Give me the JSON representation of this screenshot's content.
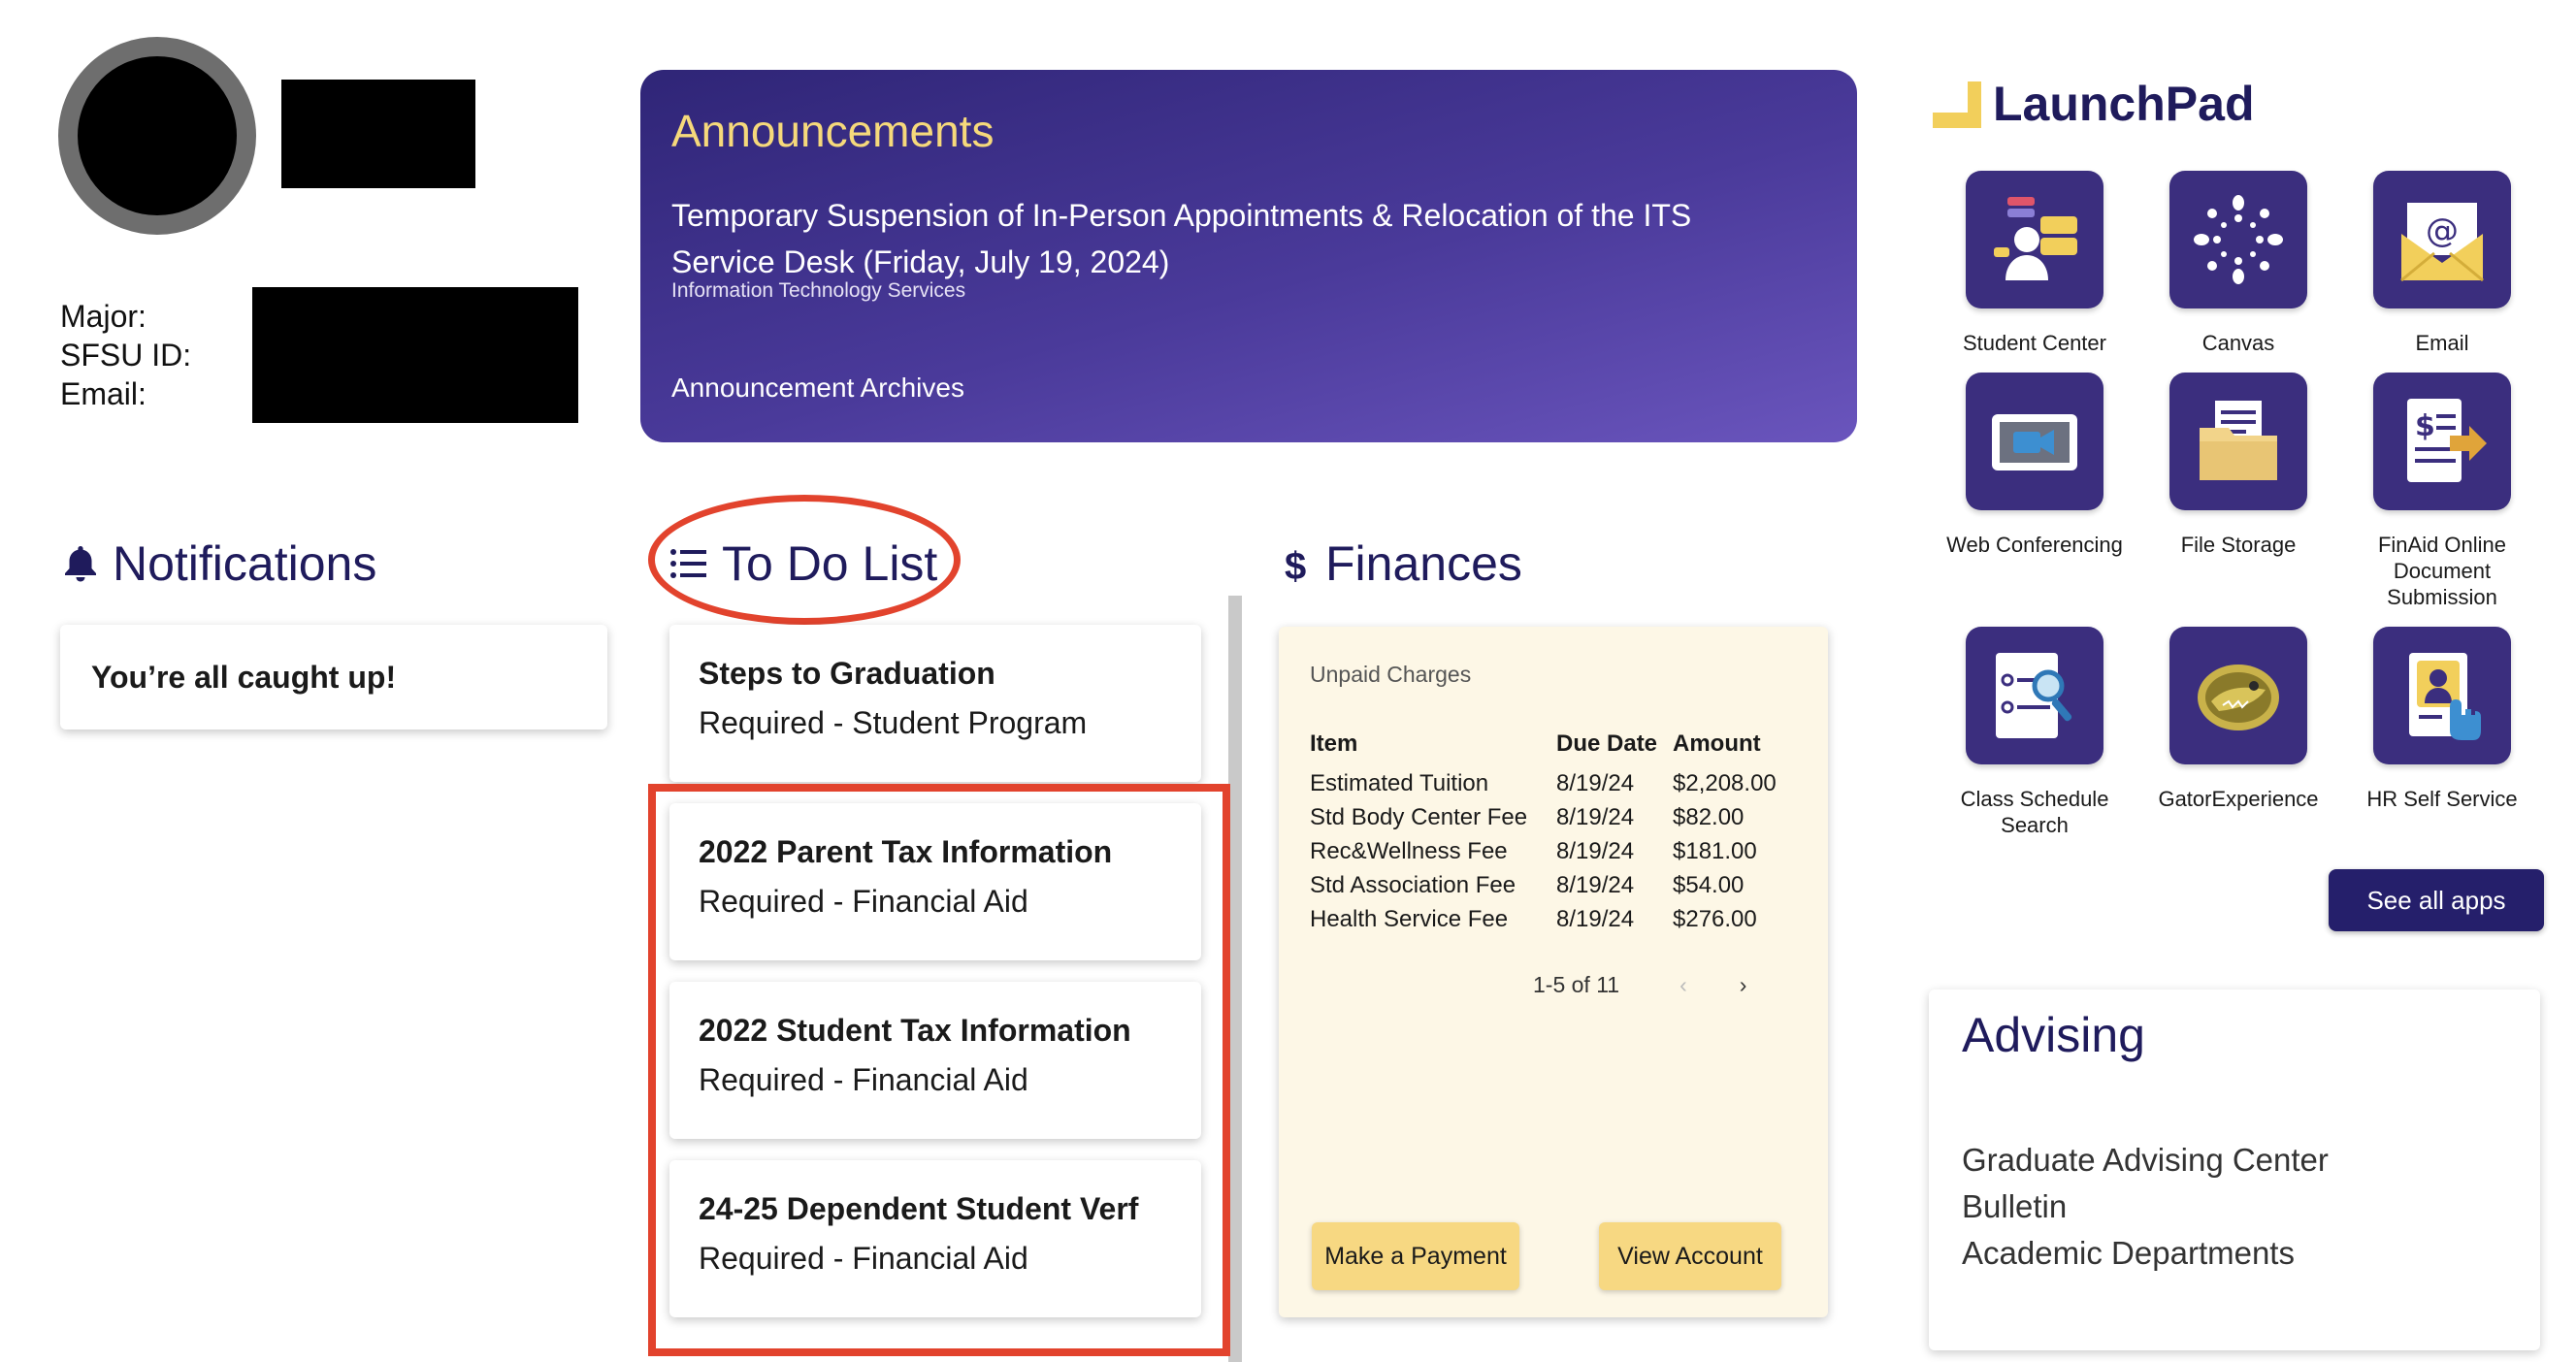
{
  "profile": {
    "labels": [
      "Major:",
      "SFSU ID:",
      "Email:"
    ]
  },
  "announcements": {
    "title": "Announcements",
    "item_title": "Temporary Suspension of In-Person Appointments & Relocation of the ITS Service Desk (Friday, July 19, 2024)",
    "item_source": "Information Technology Services",
    "archive_link": "Announcement Archives"
  },
  "notifications": {
    "title": "Notifications",
    "empty_message": "You’re all caught up!"
  },
  "todo": {
    "title": "To Do List",
    "items": [
      {
        "title": "Steps to Graduation",
        "subtitle": "Required - Student Program"
      },
      {
        "title": "2022 Parent Tax Information",
        "subtitle": "Required - Financial Aid"
      },
      {
        "title": "2022 Student Tax Information",
        "subtitle": "Required - Financial Aid"
      },
      {
        "title": "24-25 Dependent Student Verf",
        "subtitle": "Required - Financial Aid"
      }
    ]
  },
  "finances": {
    "title": "Finances",
    "card_label": "Unpaid Charges",
    "columns": [
      "Item",
      "Due Date",
      "Amount"
    ],
    "rows": [
      [
        "Estimated Tuition",
        "8/19/24",
        "$2,208.00"
      ],
      [
        "Std Body Center Fee",
        "8/19/24",
        "$82.00"
      ],
      [
        "Rec&Wellness Fee",
        "8/19/24",
        "$181.00"
      ],
      [
        "Std Association Fee",
        "8/19/24",
        "$54.00"
      ],
      [
        "Health Service Fee",
        "8/19/24",
        "$276.00"
      ]
    ],
    "pager": "1-5 of 11",
    "pay_button": "Make a Payment",
    "view_button": "View Account"
  },
  "launchpad": {
    "title": "LaunchPad",
    "apps": [
      {
        "label": "Student Center",
        "icon": "student-center-icon"
      },
      {
        "label": "Canvas",
        "icon": "canvas-icon"
      },
      {
        "label": "Email",
        "icon": "email-icon"
      },
      {
        "label": "Web Conferencing",
        "icon": "video-camera-icon"
      },
      {
        "label": "File Storage",
        "icon": "folder-icon"
      },
      {
        "label": "FinAid Online Document Submission",
        "icon": "finaid-document-icon"
      },
      {
        "label": "Class Schedule Search",
        "icon": "schedule-search-icon"
      },
      {
        "label": "GatorExperience",
        "icon": "gator-icon"
      },
      {
        "label": "HR Self Service",
        "icon": "hr-badge-icon"
      }
    ],
    "see_all": "See all apps"
  },
  "advising": {
    "title": "Advising",
    "links": [
      "Graduate Advising Center",
      "Bulletin",
      "Academic Departments"
    ]
  },
  "colors": {
    "navy": "#1f1b5c",
    "announce_gold": "#f6d97b",
    "highlight_red": "#e2432d",
    "button_gold": "#f7d882",
    "tile_purple": "#3b2e7e"
  }
}
